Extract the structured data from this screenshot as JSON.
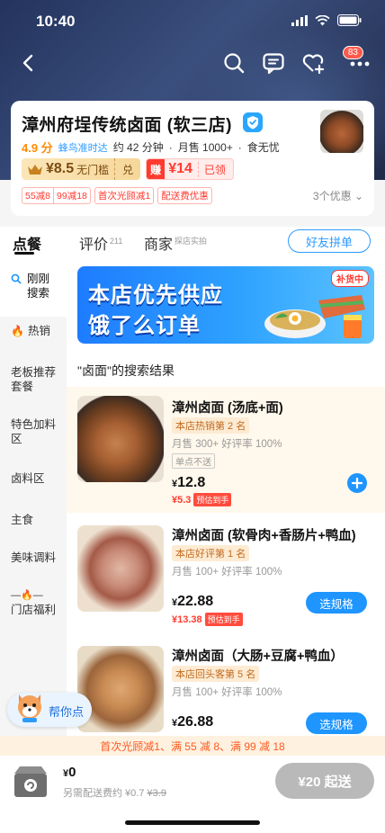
{
  "status": {
    "time": "10:40"
  },
  "nav": {
    "badge": "83"
  },
  "store": {
    "name": "漳州府埕传统卤面 (软三店)",
    "rating": "4.9 分",
    "delivery_brand": "蜂鸟准时达",
    "delivery_time": "约 42 分钟",
    "monthly_sales": "月售 1000+",
    "food_tag": "食无忧",
    "coupon1_value": "¥8.5",
    "coupon1_desc": "无门槛",
    "coupon1_action": "兑",
    "coupon2_tag": "赚",
    "coupon2_value": "¥14",
    "coupon2_status": "已领",
    "promos": [
      "55减8",
      "99减18",
      "首次光顾减1",
      "配送费优惠"
    ],
    "more_promos": "3个优惠"
  },
  "tabs": {
    "order": "点餐",
    "reviews": "评价",
    "reviews_count": "211",
    "merchant": "商家",
    "merchant_sub": "探店实拍",
    "group_order": "好友拼单"
  },
  "sidebar": {
    "items": [
      {
        "label": "刚刚搜索",
        "icon": "search-icon"
      },
      {
        "label": "热销",
        "icon": "fire-icon"
      },
      {
        "label": "老板推荐套餐"
      },
      {
        "label": "特色加料区"
      },
      {
        "label": "卤料区"
      },
      {
        "label": "主食"
      },
      {
        "label": "美味调料"
      },
      {
        "label": "门店福利",
        "icon": "fire-icon"
      }
    ]
  },
  "banner": {
    "line1": "本店优先供应",
    "line2": "饿了么订单",
    "badge": "补货中"
  },
  "results": {
    "title": "\"卤面\"的搜索结果",
    "items": [
      {
        "name": "漳州卤面 (汤底+面)",
        "rank": "本店热销第 2 名",
        "sales": "月售 300+ 好评率 100%",
        "note": "单点不送",
        "price": "12.8",
        "sub_price": "¥5.3",
        "sub_tag": "预估到手"
      },
      {
        "name": "漳州卤面 (软骨肉+香肠片+鸭血)",
        "rank": "本店好评第 1 名",
        "sales": "月售 100+ 好评率 100%",
        "price": "22.88",
        "sub_price": "¥13.38",
        "sub_tag": "预估到手",
        "button": "选规格"
      },
      {
        "name": "漳州卤面（大肠+豆腐+鸭血）",
        "rank": "本店回头客第 5 名",
        "sales": "月售 100+ 好评率 100%",
        "price": "26.88",
        "button": "选规格"
      }
    ]
  },
  "helper": {
    "label": "帮你点"
  },
  "promo_bar": "首次光顾减1、满 55 减 8、满 99 减 18",
  "cart": {
    "total": "0",
    "fee_label": "另需配送费约 ¥0.7",
    "fee_original": "¥3.9",
    "checkout": "¥20 起送"
  },
  "colors": {
    "accent": "#1e95ff",
    "price_red": "#ff3b30",
    "hero": "#2c3d66"
  }
}
